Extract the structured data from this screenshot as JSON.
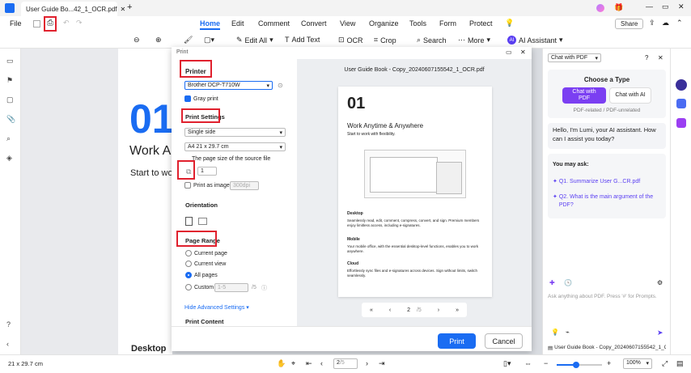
{
  "tabs": {
    "active": "User Guide Bo...42_1_OCR.pdf",
    "add": "+"
  },
  "file_menu": "File",
  "menu": [
    "Home",
    "Edit",
    "Comment",
    "Convert",
    "View",
    "Organize",
    "Tools",
    "Form",
    "Protect"
  ],
  "share_label": "Share",
  "toolbar": {
    "edit_all": "Edit All",
    "add_text": "Add Text",
    "ocr": "OCR",
    "crop": "Crop",
    "search": "Search",
    "more": "More",
    "ai_assistant": "AI Assistant"
  },
  "doc": {
    "big_number": "01",
    "heading": "Work A",
    "line": "Start to wo",
    "footer": "Desktop"
  },
  "dialog": {
    "title": "Print",
    "printer_label": "Printer",
    "printer_value": "Brother DCP-T710W",
    "gray_print": "Gray print",
    "print_settings_label": "Print Settings",
    "sides": "Single side",
    "paper": "A4 21 x 29.7 cm",
    "page_size_opt": "The page size of the source file",
    "copies": "1",
    "print_as_image": "Print as image",
    "dpi": "300dpi",
    "orientation_label": "Orientation",
    "page_range_label": "Page Range",
    "range_current_page": "Current page",
    "range_current_view": "Current view",
    "range_all": "All pages",
    "range_custom": "Custom",
    "custom_placeholder": "1-5",
    "custom_total": "/5",
    "advanced": "Hide Advanced Settings",
    "print_content": "Print Content",
    "print_btn": "Print",
    "cancel_btn": "Cancel",
    "preview_title": "User Guide Book - Copy_20240607155542_1_OCR.pdf",
    "pager_current": "2",
    "pager_total": "/5",
    "preview": {
      "number": "01",
      "heading": "Work Anytime & Anywhere",
      "sub": "Start to work with flexibility.",
      "sec1": "Desktop",
      "sec1_text": "Seamlessly read, edit, comment, compress, convert, and sign. Premium members enjoy limitless access, including e-signatures.",
      "sec2": "Mobile",
      "sec2_text": "Your mobile office, with the essential desktop-level functions, enables you to work anywhere.",
      "sec3": "Cloud",
      "sec3_text": "Effortlessly sync files and e-signatures across devices. Sign without limits, switch seamlessly."
    }
  },
  "ai": {
    "mode": "Chat with PDF",
    "choose": "Choose a Type",
    "chat_pdf": "Chat with PDF",
    "chat_ai": "Chat with AI",
    "desc": "PDF-related / PDF-unrelated",
    "greeting": "Hello, I'm Lumi, your AI assistant. How can I assist you today?",
    "may_ask": "You may ask:",
    "q1": "Q1. Summarize User G...CR.pdf",
    "q2": "Q2. What is the main argument of the PDF?",
    "input_placeholder": "Ask anything about PDF. Press '#' for Prompts.",
    "file": "User Guide Book - Copy_20240607155542_1_OCR.pdf"
  },
  "status": {
    "size": "21 x 29.7 cm",
    "page_current": "2",
    "page_total": "/5",
    "zoom": "100%"
  },
  "colors": {
    "accent": "#1a6cf2",
    "red_highlight": "#e0212e",
    "ai_purple": "#7b3ff2"
  }
}
